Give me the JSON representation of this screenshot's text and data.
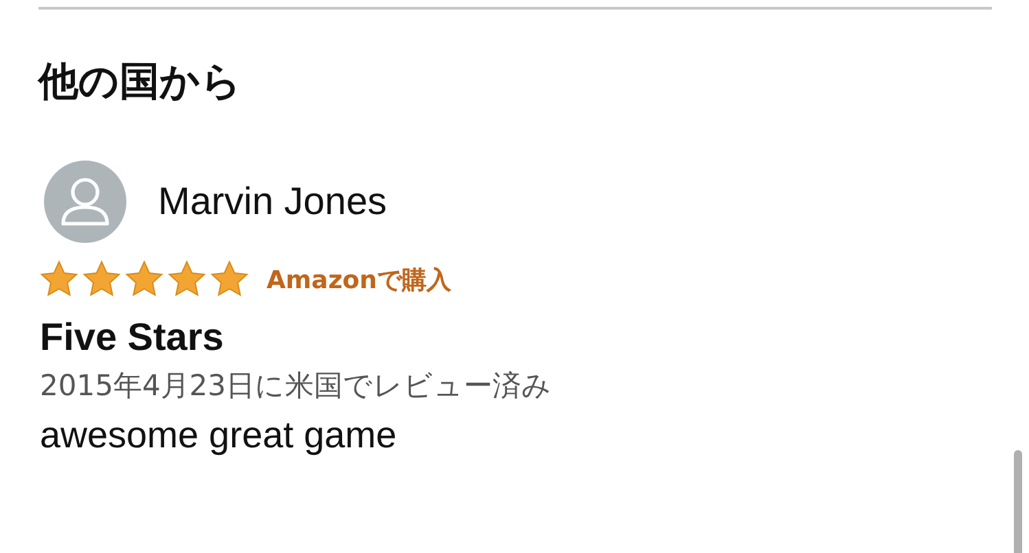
{
  "section": {
    "title": "他の国から"
  },
  "reviews": [
    {
      "author": "Marvin Jones",
      "stars": 5,
      "badge": "Amazonで購入",
      "title": "Five Stars",
      "date": "2015年4月23日に米国でレビュー済み",
      "body": "awesome great game"
    }
  ]
}
